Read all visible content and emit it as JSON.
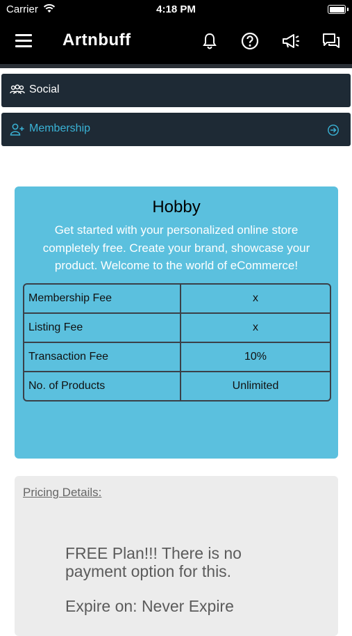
{
  "status_bar": {
    "carrier": "Carrier",
    "time": "4:18 PM"
  },
  "header": {
    "title": "Artnbuff",
    "icons": [
      "menu-icon",
      "bell-icon",
      "help-icon",
      "megaphone-icon",
      "chat-icon"
    ]
  },
  "sections": {
    "social_label": "Social",
    "membership_label": "Membership"
  },
  "plan": {
    "title": "Hobby",
    "description": "Get started with your personalized online store completely free. Create your brand, showcase your product. Welcome to the world of eCommerce!",
    "fees": [
      {
        "label": "Membership Fee",
        "value": "x"
      },
      {
        "label": "Listing Fee",
        "value": "x"
      },
      {
        "label": "Transaction Fee",
        "value": "10%"
      },
      {
        "label": "No. of Products",
        "value": "Unlimited"
      }
    ]
  },
  "pricing": {
    "title": "Pricing Details:",
    "body": "FREE Plan!!! There is no payment option for this.",
    "expire": "Expire on: Never Expire"
  },
  "colors": {
    "header_bg": "#000000",
    "section_bg": "#1e2a35",
    "accent": "#3ab3d6",
    "plan_bg": "#5bc0de",
    "pricing_bg": "#ececec"
  }
}
